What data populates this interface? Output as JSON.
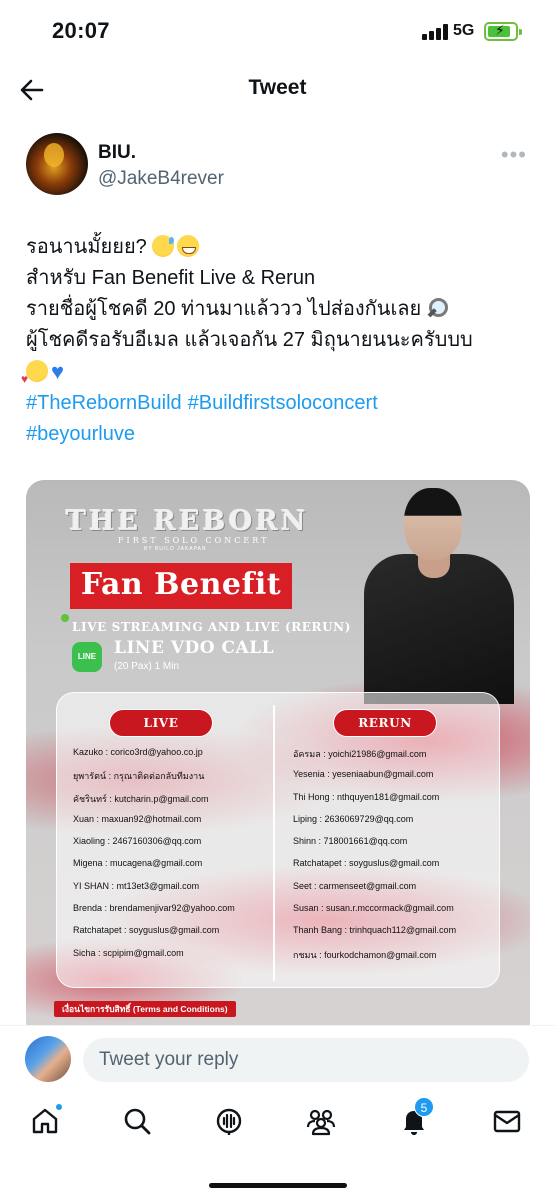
{
  "status_bar": {
    "time": "20:07",
    "network": "5G"
  },
  "header": {
    "title": "Tweet"
  },
  "author": {
    "name": "BIU.",
    "handle": "@JakeB4rever"
  },
  "tweet": {
    "line1": "รอนานมั้ยยย?",
    "line2": "สำหรับ Fan Benefit  Live & Rerun",
    "line3": "รายชื่อผู้โชคดี 20 ท่านมาแล้ววว ไปส่องกันเลย",
    "line4": "ผู้โชคดีรอรับอีเมล แล้วเจอกัน 27 มิถุนายนนะครับบบ",
    "hashtags": [
      "#TheRebornBuild",
      "#Buildfirstsoloconcert",
      "#beyourluve"
    ]
  },
  "poster": {
    "title": "THE REBORN",
    "subtitle": "FIRST SOLO CONCERT",
    "subtitle2": "BY BUILD JAKAPAN",
    "banner": "Fan Benefit",
    "streaming": "LIVE STREAMING AND LIVE (RERUN)",
    "line_icon": "LINE",
    "line_call": "LINE VDO CALL",
    "pax": "(20 Pax) 1 Min",
    "live_header": "LIVE",
    "rerun_header": "RERUN",
    "live_list": [
      "Kazuko : corico3rd@yahoo.co.jp",
      "ยุพารัตน์ : กรุณาติดต่อกลับทีมงาน",
      "คัชรินทร์ : kutcharin.p@gmail.com",
      "Xuan : maxuan92@hotmail.com",
      "Xiaoling : 2467160306@qq.com",
      "Migena : mucagena@gmail.com",
      "YI SHAN : mt13et3@gmail.com",
      "Brenda : brendamenjivar92@yahoo.com",
      "Ratchatapet : soyguslus@gmail.com",
      "Sicha : scpipim@gmail.com"
    ],
    "rerun_list": [
      "อัครมล : yoichi21986@gmail.com",
      "Yesenia : yeseniaabun@gmail.com",
      "Thi Hong : nthquyen181@gmail.com",
      "Liping : 2636069729@qq.com",
      "Shinn : 718001661@qq.com",
      "Ratchatapet : soyguslus@gmail.com",
      "Seet : carmenseet@gmail.com",
      "Susan : susan.r.mccormack@gmail.com",
      "Thanh Bang : trinhquach112@gmail.com",
      "กชมน : fourkodchamon@gmail.com"
    ],
    "terms": "เงื่อนไขการรับสิทธิ์ (Terms and Conditions)"
  },
  "reply": {
    "placeholder": "Tweet your reply"
  },
  "tabs": {
    "notifications_count": "5",
    "items": [
      "home-icon",
      "search-icon",
      "spaces-icon",
      "communities-icon",
      "notifications-icon",
      "messages-icon"
    ]
  },
  "colors": {
    "accent": "#1d9bf0",
    "poster_red": "#d91f26"
  }
}
